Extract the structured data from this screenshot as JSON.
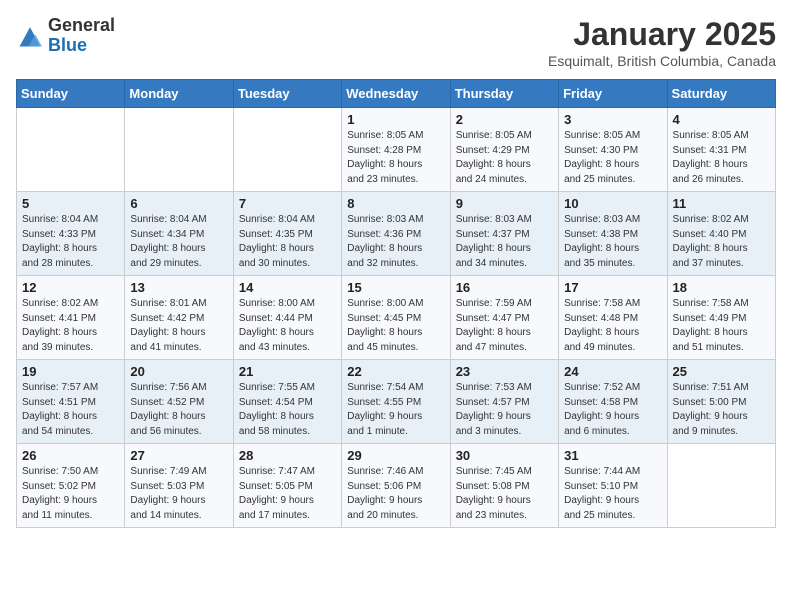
{
  "header": {
    "logo_general": "General",
    "logo_blue": "Blue",
    "title": "January 2025",
    "subtitle": "Esquimalt, British Columbia, Canada"
  },
  "days_of_week": [
    "Sunday",
    "Monday",
    "Tuesday",
    "Wednesday",
    "Thursday",
    "Friday",
    "Saturday"
  ],
  "weeks": [
    [
      {
        "num": "",
        "info": ""
      },
      {
        "num": "",
        "info": ""
      },
      {
        "num": "",
        "info": ""
      },
      {
        "num": "1",
        "info": "Sunrise: 8:05 AM\nSunset: 4:28 PM\nDaylight: 8 hours\nand 23 minutes."
      },
      {
        "num": "2",
        "info": "Sunrise: 8:05 AM\nSunset: 4:29 PM\nDaylight: 8 hours\nand 24 minutes."
      },
      {
        "num": "3",
        "info": "Sunrise: 8:05 AM\nSunset: 4:30 PM\nDaylight: 8 hours\nand 25 minutes."
      },
      {
        "num": "4",
        "info": "Sunrise: 8:05 AM\nSunset: 4:31 PM\nDaylight: 8 hours\nand 26 minutes."
      }
    ],
    [
      {
        "num": "5",
        "info": "Sunrise: 8:04 AM\nSunset: 4:33 PM\nDaylight: 8 hours\nand 28 minutes."
      },
      {
        "num": "6",
        "info": "Sunrise: 8:04 AM\nSunset: 4:34 PM\nDaylight: 8 hours\nand 29 minutes."
      },
      {
        "num": "7",
        "info": "Sunrise: 8:04 AM\nSunset: 4:35 PM\nDaylight: 8 hours\nand 30 minutes."
      },
      {
        "num": "8",
        "info": "Sunrise: 8:03 AM\nSunset: 4:36 PM\nDaylight: 8 hours\nand 32 minutes."
      },
      {
        "num": "9",
        "info": "Sunrise: 8:03 AM\nSunset: 4:37 PM\nDaylight: 8 hours\nand 34 minutes."
      },
      {
        "num": "10",
        "info": "Sunrise: 8:03 AM\nSunset: 4:38 PM\nDaylight: 8 hours\nand 35 minutes."
      },
      {
        "num": "11",
        "info": "Sunrise: 8:02 AM\nSunset: 4:40 PM\nDaylight: 8 hours\nand 37 minutes."
      }
    ],
    [
      {
        "num": "12",
        "info": "Sunrise: 8:02 AM\nSunset: 4:41 PM\nDaylight: 8 hours\nand 39 minutes."
      },
      {
        "num": "13",
        "info": "Sunrise: 8:01 AM\nSunset: 4:42 PM\nDaylight: 8 hours\nand 41 minutes."
      },
      {
        "num": "14",
        "info": "Sunrise: 8:00 AM\nSunset: 4:44 PM\nDaylight: 8 hours\nand 43 minutes."
      },
      {
        "num": "15",
        "info": "Sunrise: 8:00 AM\nSunset: 4:45 PM\nDaylight: 8 hours\nand 45 minutes."
      },
      {
        "num": "16",
        "info": "Sunrise: 7:59 AM\nSunset: 4:47 PM\nDaylight: 8 hours\nand 47 minutes."
      },
      {
        "num": "17",
        "info": "Sunrise: 7:58 AM\nSunset: 4:48 PM\nDaylight: 8 hours\nand 49 minutes."
      },
      {
        "num": "18",
        "info": "Sunrise: 7:58 AM\nSunset: 4:49 PM\nDaylight: 8 hours\nand 51 minutes."
      }
    ],
    [
      {
        "num": "19",
        "info": "Sunrise: 7:57 AM\nSunset: 4:51 PM\nDaylight: 8 hours\nand 54 minutes."
      },
      {
        "num": "20",
        "info": "Sunrise: 7:56 AM\nSunset: 4:52 PM\nDaylight: 8 hours\nand 56 minutes."
      },
      {
        "num": "21",
        "info": "Sunrise: 7:55 AM\nSunset: 4:54 PM\nDaylight: 8 hours\nand 58 minutes."
      },
      {
        "num": "22",
        "info": "Sunrise: 7:54 AM\nSunset: 4:55 PM\nDaylight: 9 hours\nand 1 minute."
      },
      {
        "num": "23",
        "info": "Sunrise: 7:53 AM\nSunset: 4:57 PM\nDaylight: 9 hours\nand 3 minutes."
      },
      {
        "num": "24",
        "info": "Sunrise: 7:52 AM\nSunset: 4:58 PM\nDaylight: 9 hours\nand 6 minutes."
      },
      {
        "num": "25",
        "info": "Sunrise: 7:51 AM\nSunset: 5:00 PM\nDaylight: 9 hours\nand 9 minutes."
      }
    ],
    [
      {
        "num": "26",
        "info": "Sunrise: 7:50 AM\nSunset: 5:02 PM\nDaylight: 9 hours\nand 11 minutes."
      },
      {
        "num": "27",
        "info": "Sunrise: 7:49 AM\nSunset: 5:03 PM\nDaylight: 9 hours\nand 14 minutes."
      },
      {
        "num": "28",
        "info": "Sunrise: 7:47 AM\nSunset: 5:05 PM\nDaylight: 9 hours\nand 17 minutes."
      },
      {
        "num": "29",
        "info": "Sunrise: 7:46 AM\nSunset: 5:06 PM\nDaylight: 9 hours\nand 20 minutes."
      },
      {
        "num": "30",
        "info": "Sunrise: 7:45 AM\nSunset: 5:08 PM\nDaylight: 9 hours\nand 23 minutes."
      },
      {
        "num": "31",
        "info": "Sunrise: 7:44 AM\nSunset: 5:10 PM\nDaylight: 9 hours\nand 25 minutes."
      },
      {
        "num": "",
        "info": ""
      }
    ]
  ]
}
